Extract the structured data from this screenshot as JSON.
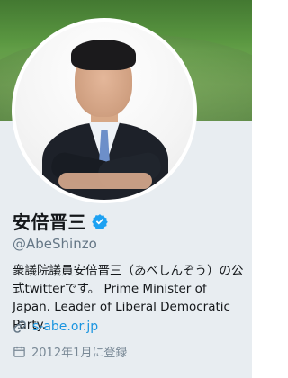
{
  "profile": {
    "display_name": "安倍晋三",
    "handle": "@AbeShinzo",
    "bio": "衆議院議員安倍晋三（あべしんぞう）の公式twitterです。 Prime Minister of Japan. Leader of Liberal Democratic Party.",
    "website": "s-abe.or.jp",
    "joined": "2012年1月に登録",
    "verified": true
  },
  "icons": {
    "verified": "verified-badge-icon",
    "link": "link-icon",
    "calendar": "calendar-icon"
  },
  "colors": {
    "verified_blue": "#1da1f2",
    "link_blue": "#1b95e0",
    "secondary_text": "#657786",
    "background": "#e8edf1"
  }
}
